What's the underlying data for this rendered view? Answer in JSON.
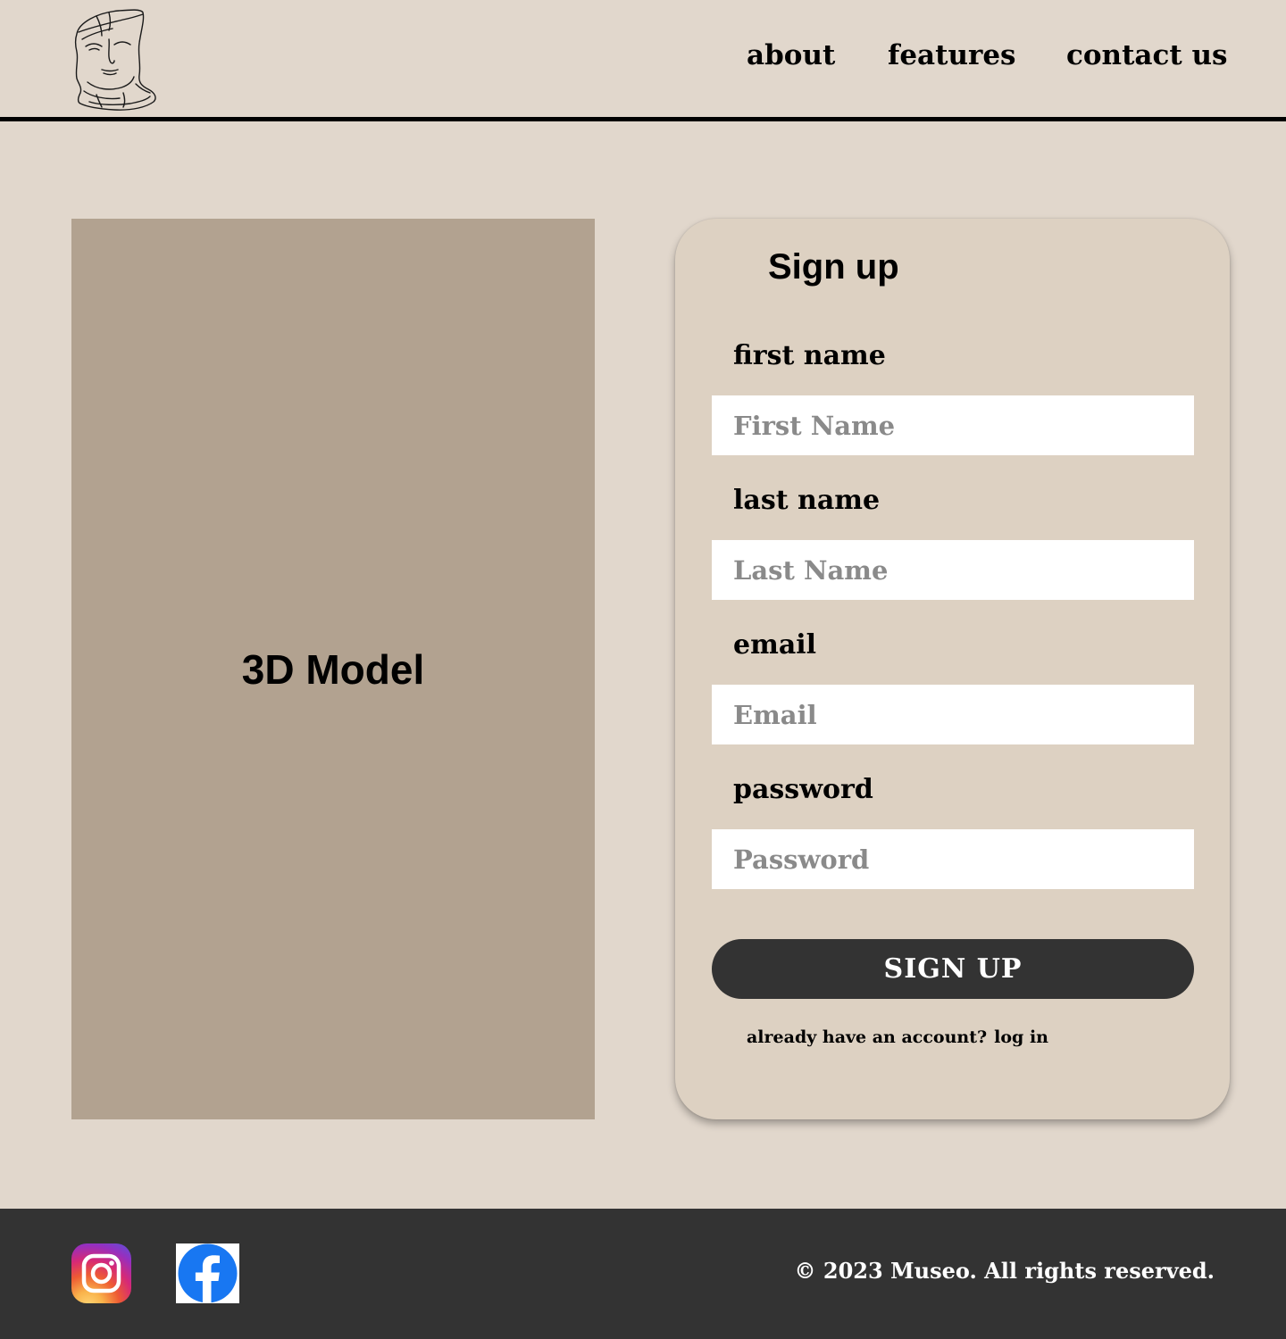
{
  "header": {
    "logo_icon": "sculpture-head-sketch-icon",
    "nav": {
      "about": "about",
      "features": "features",
      "contact": "contact us"
    }
  },
  "model_panel": {
    "label": "3D Model"
  },
  "signup": {
    "title": "Sign up",
    "fields": {
      "first_name": {
        "label": "first name",
        "placeholder": "First Name",
        "value": ""
      },
      "last_name": {
        "label": "last name",
        "placeholder": "Last Name",
        "value": ""
      },
      "email": {
        "label": "email",
        "placeholder": "Email",
        "value": ""
      },
      "password": {
        "label": "password",
        "placeholder": "Password",
        "value": ""
      }
    },
    "submit_label": "SIGN UP",
    "login_prompt": "already have an account?",
    "login_link": "log in"
  },
  "footer": {
    "social": [
      "instagram-icon",
      "facebook-icon"
    ],
    "copyright": "© 2023 Museo. All rights reserved."
  },
  "colors": {
    "page_background": "#e1d7cc",
    "card_background": "#ddd1c2",
    "model_placeholder": "#b2a290",
    "dark": "#333333",
    "input_background": "#ffffff",
    "placeholder_text": "#8a8a8a",
    "facebook_blue": "#1877f2"
  }
}
